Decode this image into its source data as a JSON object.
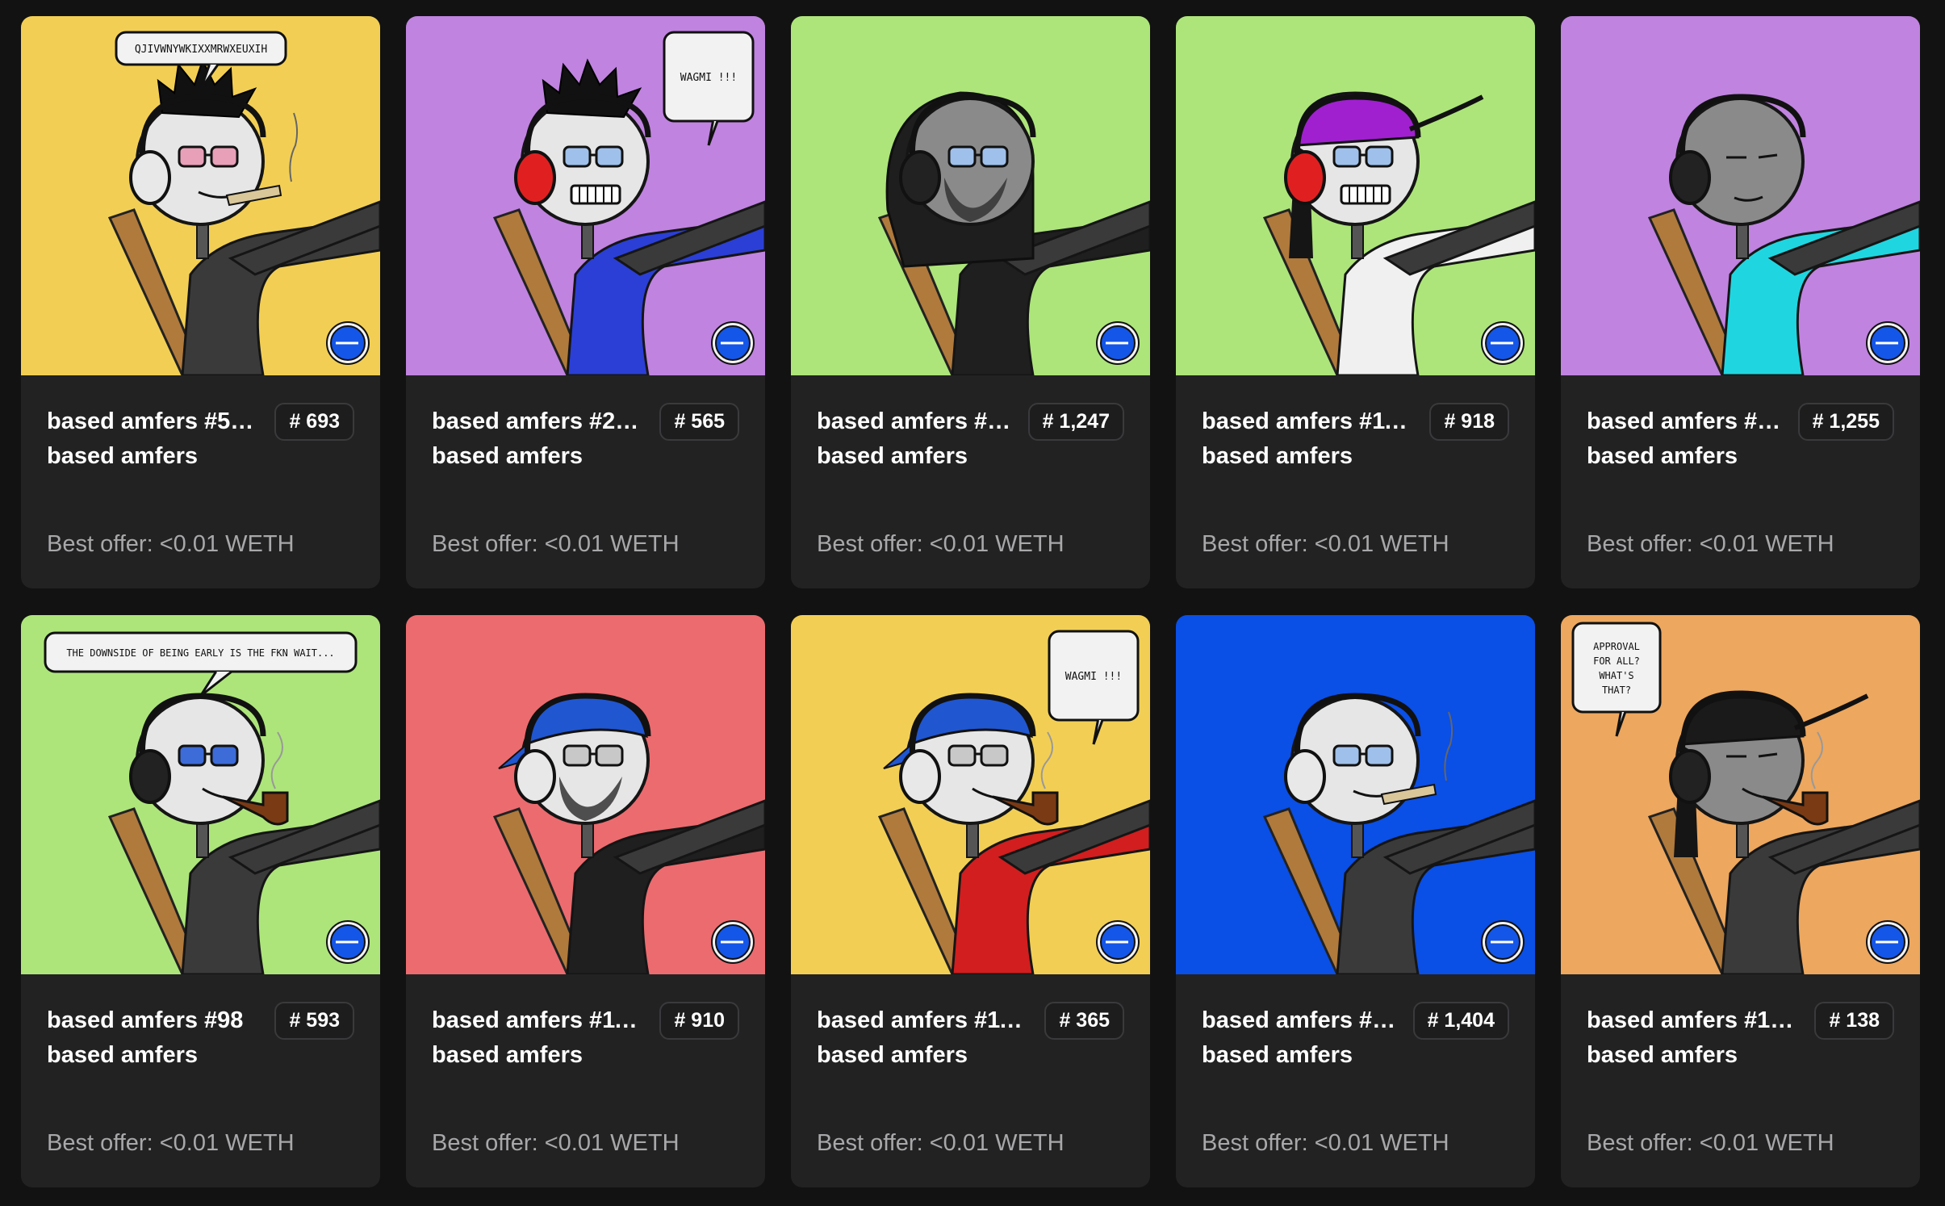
{
  "common": {
    "collection_label": "based amfers",
    "best_offer_label": "Best offer: <0.01 WETH"
  },
  "colors": {
    "page_bg": "#121212",
    "card_bg": "#222223",
    "yellow": "#f2cf54",
    "purple": "#c083e0",
    "green": "#ade57a",
    "pink": "#ec6b6f",
    "blue": "#0a4fe6",
    "orange": "#eda75e"
  },
  "cards": [
    {
      "name": "based amfers #5…",
      "rank": "# 693",
      "bg": "#f2cf54",
      "speech": "QJIVWNYWKIXXMRWXEUXIH",
      "hair": "mohawk",
      "headphone": "#e8e8e8",
      "shirt": "#3a3a3a",
      "glasses": "#e8a0b8",
      "prop": "cigarette"
    },
    {
      "name": "based amfers #2…",
      "rank": "# 565",
      "bg": "#c083e0",
      "speech": "WAGMI !!!",
      "hair": "mohawk",
      "headphone": "#e02020",
      "shirt": "#2b3fd6",
      "glasses": "#9fc0ea",
      "prop": "teeth"
    },
    {
      "name": "based amfers #…",
      "rank": "# 1,247",
      "bg": "#ade57a",
      "speech": "",
      "hair": "hood",
      "headphone": "#222222",
      "shirt": "#1f1f1f",
      "glasses": "#9fc0ea",
      "prop": "beard"
    },
    {
      "name": "based amfers #11…",
      "rank": "# 918",
      "bg": "#ade57a",
      "speech": "",
      "hair": "cap-purple",
      "headphone": "#e02020",
      "shirt": "#f0f0f0",
      "glasses": "#9fc0ea",
      "prop": "teeth"
    },
    {
      "name": "based amfers #…",
      "rank": "# 1,255",
      "bg": "#c083e0",
      "speech": "",
      "hair": "none",
      "headphone": "#222222",
      "shirt": "#1fd6e0",
      "glasses": "none",
      "prop": "none"
    },
    {
      "name": "based amfers #98",
      "rank": "# 593",
      "bg": "#ade57a",
      "speech": "THE DOWNSIDE OF BEING EARLY IS THE FKN WAIT...",
      "hair": "none",
      "headphone": "#222222",
      "shirt": "#3a3a3a",
      "glasses": "#3d6bd8",
      "prop": "pipe"
    },
    {
      "name": "based amfers #11…",
      "rank": "# 910",
      "bg": "#ec6b6f",
      "speech": "",
      "hair": "bandana",
      "headphone": "#e8e8e8",
      "shirt": "#1f1f1f",
      "glasses": "#c8c8c8",
      "prop": "beard"
    },
    {
      "name": "based amfers #11…",
      "rank": "# 365",
      "bg": "#f2cf54",
      "speech": "WAGMI !!!",
      "hair": "bandana",
      "headphone": "#e8e8e8",
      "shirt": "#d21e1e",
      "glasses": "#c8c8c8",
      "prop": "pipe"
    },
    {
      "name": "based amfers #…",
      "rank": "# 1,404",
      "bg": "#0a4fe6",
      "speech": "",
      "hair": "none",
      "headphone": "#e8e8e8",
      "shirt": "#3a3a3a",
      "glasses": "#9fc0ea",
      "prop": "cigarette"
    },
    {
      "name": "based amfers #1…",
      "rank": "# 138",
      "bg": "#eda75e",
      "speech": "APPROVAL FOR ALL? WHAT'S THAT?",
      "hair": "cap-black",
      "headphone": "#222222",
      "shirt": "#3a3a3a",
      "glasses": "none",
      "prop": "pipe"
    }
  ]
}
